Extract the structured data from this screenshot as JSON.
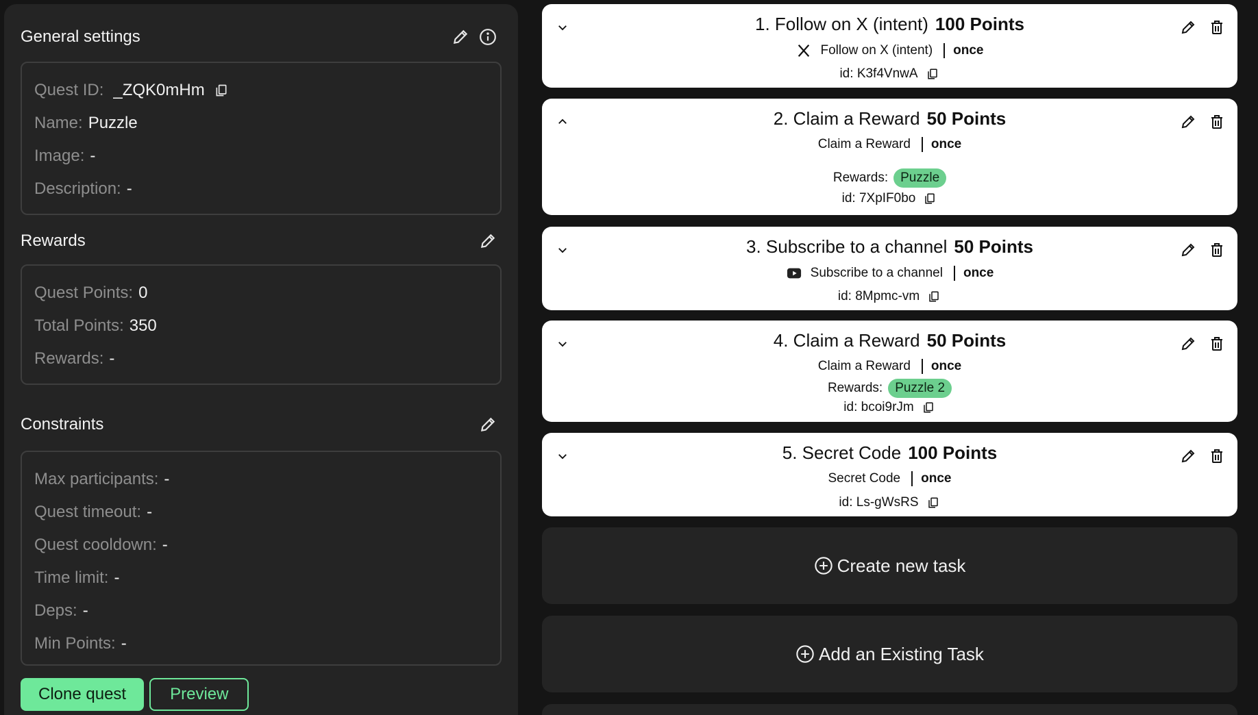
{
  "general": {
    "title": "General settings",
    "quest_id_label": "Quest ID:",
    "quest_id": "_ZQK0mHm",
    "name_label": "Name:",
    "name": "Puzzle",
    "image_label": "Image:",
    "image": "-",
    "description_label": "Description:",
    "description": "-"
  },
  "rewards": {
    "title": "Rewards",
    "quest_points_label": "Quest Points:",
    "quest_points": "0",
    "total_points_label": "Total Points:",
    "total_points": "350",
    "rewards_label": "Rewards:",
    "rewards": "-"
  },
  "constraints": {
    "title": "Constraints",
    "max_participants_label": "Max participants:",
    "max_participants": "-",
    "quest_timeout_label": "Quest timeout:",
    "quest_timeout": "-",
    "quest_cooldown_label": "Quest cooldown:",
    "quest_cooldown": "-",
    "time_limit_label": "Time limit:",
    "time_limit": "-",
    "deps_label": "Deps:",
    "deps": "-",
    "min_points_label": "Min Points:",
    "min_points": "-"
  },
  "actions": {
    "clone": "Clone quest",
    "preview": "Preview"
  },
  "tasks": [
    {
      "title": "1. Follow on X (intent)",
      "points": "100 Points",
      "type": "Follow on X (intent)",
      "freq": "once",
      "id_label": "id:",
      "id": "K3f4VnwA",
      "icon": "x-logo-icon"
    },
    {
      "title": "2. Claim a Reward",
      "points": "50 Points",
      "type": "Claim a Reward",
      "freq": "once",
      "rewards_label": "Rewards:",
      "reward": "Puzzle",
      "id_label": "id:",
      "id": "7XpIF0bo"
    },
    {
      "title": "3. Subscribe to a channel",
      "points": "50 Points",
      "type": "Subscribe to a channel",
      "freq": "once",
      "id_label": "id:",
      "id": "8Mpmc-vm",
      "icon": "youtube-icon"
    },
    {
      "title": "4. Claim a Reward",
      "points": "50 Points",
      "type": "Claim a Reward",
      "freq": "once",
      "rewards_label": "Rewards:",
      "reward": "Puzzle 2",
      "id_label": "id:",
      "id": "bcoi9rJm"
    },
    {
      "title": "5. Secret Code",
      "points": "100 Points",
      "type": "Secret Code",
      "freq": "once",
      "id_label": "id:",
      "id": "Ls-gWsRS"
    }
  ],
  "add": {
    "create": "Create new task",
    "existing": "Add an Existing Task"
  },
  "colors": {
    "accent": "#6ee89a",
    "panel": "#242424",
    "background": "#151515",
    "badge": "#6ccf8e"
  }
}
